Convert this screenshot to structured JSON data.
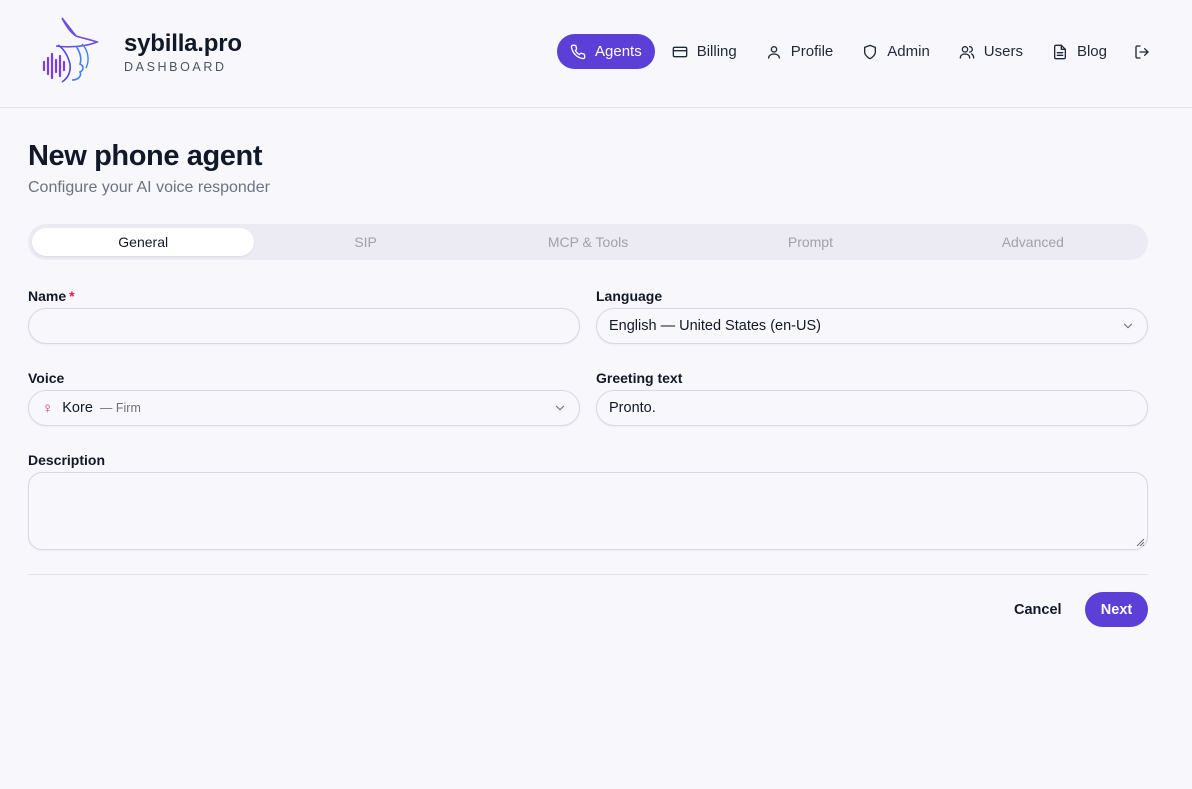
{
  "brand": {
    "name": "sybilla.pro",
    "subtitle": "DASHBOARD"
  },
  "nav": {
    "items": [
      {
        "label": "Agents",
        "icon": "phone-icon",
        "active": true
      },
      {
        "label": "Billing",
        "icon": "credit-card-icon"
      },
      {
        "label": "Profile",
        "icon": "user-icon"
      },
      {
        "label": "Admin",
        "icon": "shield-icon"
      },
      {
        "label": "Users",
        "icon": "users-icon"
      },
      {
        "label": "Blog",
        "icon": "document-icon"
      }
    ],
    "logout_icon": "logout-icon"
  },
  "page": {
    "title": "New phone agent",
    "subtitle": "Configure your AI voice responder"
  },
  "tabs": [
    {
      "label": "General",
      "active": true
    },
    {
      "label": "SIP"
    },
    {
      "label": "MCP & Tools"
    },
    {
      "label": "Prompt"
    },
    {
      "label": "Advanced"
    }
  ],
  "form": {
    "name": {
      "label": "Name",
      "required_mark": "*",
      "value": ""
    },
    "language": {
      "label": "Language",
      "value": "English — United States (en-US)"
    },
    "voice": {
      "label": "Voice",
      "symbol": "♀",
      "value": "Kore",
      "desc": "— Firm"
    },
    "greeting": {
      "label": "Greeting text",
      "value": "Pronto."
    },
    "description": {
      "label": "Description",
      "value": ""
    }
  },
  "actions": {
    "cancel": "Cancel",
    "next": "Next"
  },
  "colors": {
    "accent": "#5b3fd6",
    "background": "#f8f7fc",
    "required": "#e11d48",
    "female": "#db2777"
  }
}
